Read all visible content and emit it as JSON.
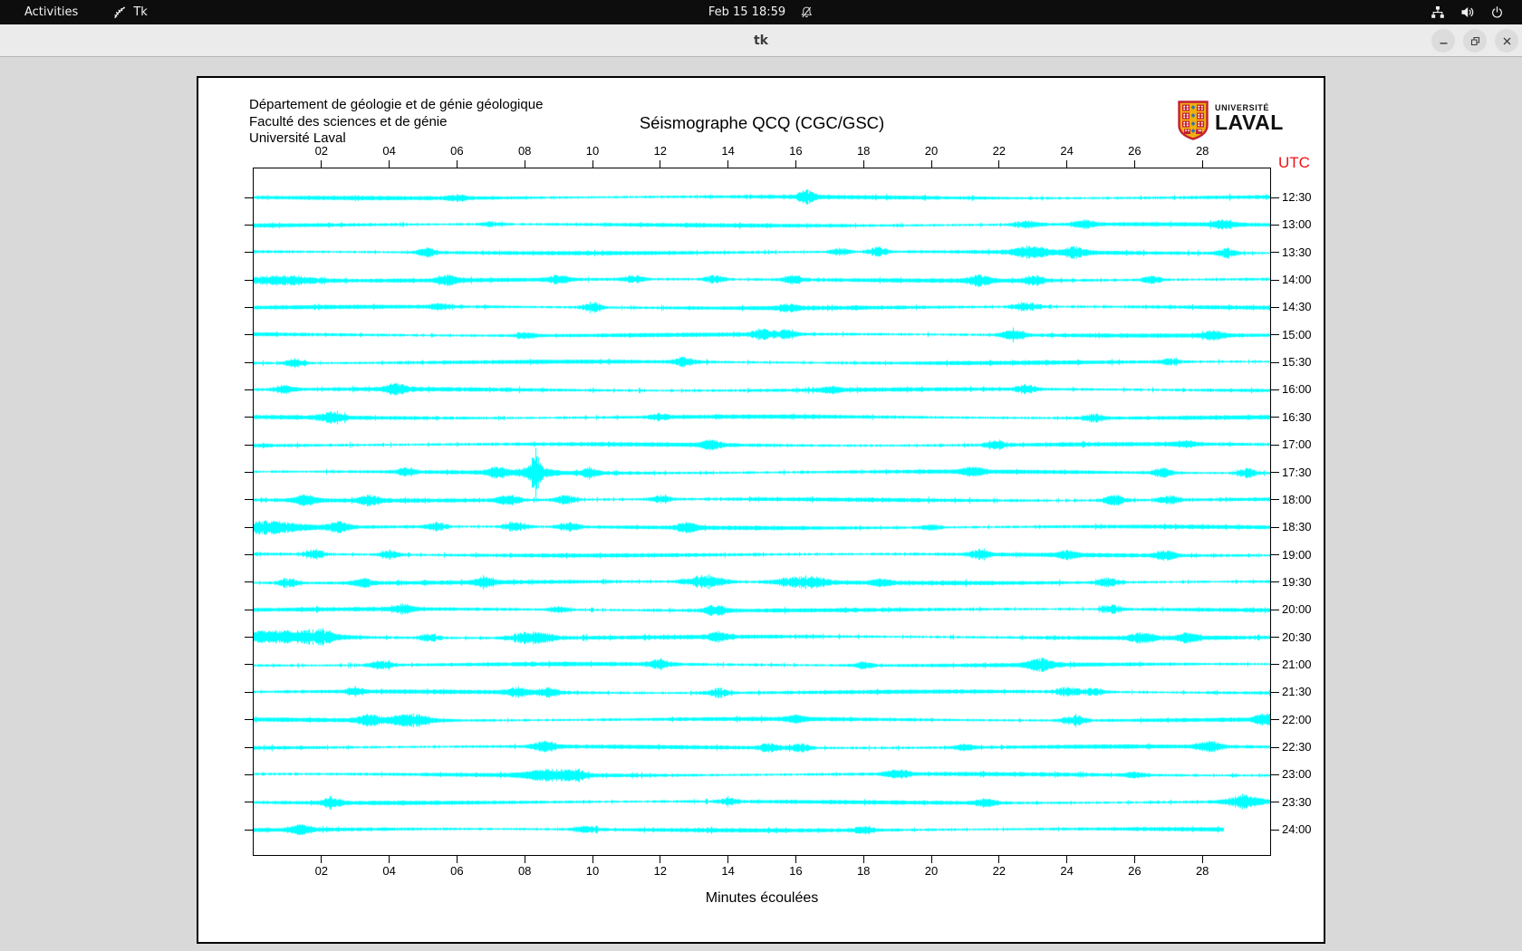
{
  "system_bar": {
    "activities_label": "Activities",
    "app_name": "Tk",
    "clock": "Feb 15 18:59"
  },
  "window": {
    "title": "tk"
  },
  "panel": {
    "header_lines": [
      "Département de géologie et de génie géologique",
      "Faculté des sciences et de génie",
      "Université Laval"
    ],
    "logo": {
      "line1": "UNIVERSITÉ",
      "line2": "LAVAL"
    }
  },
  "chart_data": {
    "type": "seismogram",
    "title": "Séismographe QCQ (CGC/GSC)",
    "xlabel": "Minutes écoulées",
    "right_axis_label": "UTC",
    "right_axis_color": "#ee1111",
    "trace_color": "#00ffff",
    "x_range_minutes": [
      0,
      30
    ],
    "x_ticks": [
      "02",
      "04",
      "06",
      "08",
      "10",
      "12",
      "14",
      "16",
      "18",
      "20",
      "22",
      "24",
      "26",
      "28"
    ],
    "rows": [
      {
        "utc": "12:30",
        "end": 30,
        "events": [
          [
            16.3,
            6,
            0.25
          ],
          [
            6.0,
            2.5,
            0.3
          ]
        ]
      },
      {
        "utc": "13:00",
        "end": 30,
        "events": [
          [
            7.0,
            2.5,
            0.3
          ],
          [
            22.8,
            3.5,
            0.4
          ],
          [
            24.5,
            3.5,
            0.3
          ],
          [
            28.6,
            3.5,
            0.3
          ]
        ]
      },
      {
        "utc": "13:30",
        "end": 30,
        "events": [
          [
            5.1,
            4.5,
            0.3
          ],
          [
            17.3,
            3.5,
            0.3
          ],
          [
            18.4,
            4.5,
            0.3
          ],
          [
            22.9,
            6,
            0.5
          ],
          [
            24.2,
            5,
            0.35
          ],
          [
            28.7,
            5,
            0.3
          ]
        ]
      },
      {
        "utc": "14:00",
        "end": 30,
        "events": [
          [
            0.8,
            5,
            1.2
          ],
          [
            5.7,
            5,
            0.3
          ],
          [
            9.0,
            4.5,
            0.3
          ],
          [
            11.2,
            4,
            0.3
          ],
          [
            13.6,
            4.5,
            0.3
          ],
          [
            15.9,
            4.5,
            0.3
          ],
          [
            21.4,
            5,
            0.35
          ],
          [
            23.0,
            4.5,
            0.3
          ],
          [
            26.5,
            3.5,
            0.3
          ]
        ]
      },
      {
        "utc": "14:30",
        "end": 30,
        "events": [
          [
            5.5,
            3,
            0.3
          ],
          [
            10.0,
            5.5,
            0.3
          ],
          [
            15.8,
            3.5,
            0.3
          ],
          [
            22.8,
            5,
            0.4
          ]
        ]
      },
      {
        "utc": "15:00",
        "end": 30,
        "events": [
          [
            8.0,
            3,
            0.3
          ],
          [
            15.0,
            5,
            0.3
          ],
          [
            15.7,
            4.5,
            0.3
          ],
          [
            22.4,
            5,
            0.35
          ],
          [
            28.3,
            4.5,
            0.3
          ]
        ]
      },
      {
        "utc": "15:30",
        "end": 30,
        "events": [
          [
            1.2,
            5,
            0.3
          ],
          [
            12.7,
            4.5,
            0.3
          ],
          [
            27.0,
            3,
            0.3
          ]
        ]
      },
      {
        "utc": "16:00",
        "end": 30,
        "events": [
          [
            0.9,
            4.5,
            0.3
          ],
          [
            4.2,
            5,
            0.35
          ],
          [
            17.0,
            3,
            0.3
          ],
          [
            22.8,
            4.5,
            0.3
          ]
        ]
      },
      {
        "utc": "16:30",
        "end": 30,
        "events": [
          [
            2.3,
            5,
            0.35
          ],
          [
            12.0,
            3,
            0.3
          ],
          [
            24.8,
            4,
            0.3
          ]
        ]
      },
      {
        "utc": "17:00",
        "end": 30,
        "events": [
          [
            13.5,
            4.5,
            0.3
          ],
          [
            21.9,
            4,
            0.3
          ],
          [
            27.5,
            3,
            0.3
          ]
        ]
      },
      {
        "utc": "17:30",
        "end": 30,
        "events": [
          [
            4.5,
            3.5,
            0.3
          ],
          [
            7.2,
            5,
            0.3
          ],
          [
            8.3,
            22,
            0.12
          ],
          [
            8.3,
            6,
            0.5
          ],
          [
            9.9,
            4.5,
            0.3
          ],
          [
            21.2,
            4.5,
            0.3
          ],
          [
            26.8,
            5,
            0.3
          ],
          [
            29.3,
            5,
            0.3
          ]
        ]
      },
      {
        "utc": "18:00",
        "end": 30,
        "events": [
          [
            1.5,
            5,
            0.35
          ],
          [
            3.4,
            4.5,
            0.3
          ],
          [
            7.5,
            5,
            0.35
          ],
          [
            9.2,
            4.5,
            0.3
          ],
          [
            12.0,
            3.5,
            0.3
          ],
          [
            25.4,
            5,
            0.35
          ],
          [
            27.0,
            4.5,
            0.3
          ]
        ]
      },
      {
        "utc": "18:30",
        "end": 30,
        "events": [
          [
            0.4,
            6,
            1.0
          ],
          [
            2.5,
            5,
            0.35
          ],
          [
            5.4,
            4.5,
            0.3
          ],
          [
            7.7,
            5,
            0.35
          ],
          [
            9.3,
            4.5,
            0.3
          ],
          [
            12.8,
            4.5,
            0.3
          ],
          [
            20.0,
            3,
            0.3
          ]
        ]
      },
      {
        "utc": "19:00",
        "end": 30,
        "events": [
          [
            1.8,
            5,
            0.3
          ],
          [
            4.0,
            4.5,
            0.3
          ],
          [
            21.4,
            4.5,
            0.3
          ],
          [
            24.0,
            3.5,
            0.3
          ],
          [
            26.9,
            4.5,
            0.3
          ]
        ]
      },
      {
        "utc": "19:30",
        "end": 30,
        "events": [
          [
            1.0,
            4.5,
            0.3
          ],
          [
            3.2,
            4.5,
            0.3
          ],
          [
            6.8,
            4.5,
            0.3
          ],
          [
            13.3,
            6.5,
            0.6
          ],
          [
            16.2,
            6,
            0.8
          ],
          [
            18.5,
            3.5,
            0.3
          ],
          [
            25.2,
            4.5,
            0.3
          ]
        ]
      },
      {
        "utc": "20:00",
        "end": 30,
        "events": [
          [
            4.4,
            4.5,
            0.3
          ],
          [
            9.0,
            3,
            0.3
          ],
          [
            13.6,
            5,
            0.35
          ],
          [
            25.3,
            4.5,
            0.3
          ]
        ]
      },
      {
        "utc": "20:30",
        "end": 30,
        "events": [
          [
            0.8,
            6,
            1.4
          ],
          [
            2.0,
            5,
            0.4
          ],
          [
            5.2,
            4.5,
            0.3
          ],
          [
            8.2,
            6,
            0.7
          ],
          [
            13.7,
            4.5,
            0.3
          ],
          [
            26.2,
            5,
            0.35
          ],
          [
            27.6,
            4.5,
            0.3
          ]
        ]
      },
      {
        "utc": "21:00",
        "end": 30,
        "events": [
          [
            3.7,
            5,
            0.35
          ],
          [
            12.0,
            4.5,
            0.3
          ],
          [
            18.0,
            3,
            0.3
          ],
          [
            23.2,
            6,
            0.4
          ]
        ]
      },
      {
        "utc": "21:30",
        "end": 30,
        "events": [
          [
            3.0,
            3,
            0.3
          ],
          [
            7.8,
            5,
            0.35
          ],
          [
            8.7,
            4.5,
            0.3
          ],
          [
            13.7,
            5,
            0.35
          ],
          [
            24.0,
            5,
            0.35
          ],
          [
            24.8,
            4.5,
            0.3
          ]
        ]
      },
      {
        "utc": "22:00",
        "end": 30,
        "events": [
          [
            3.4,
            5,
            0.35
          ],
          [
            4.6,
            6.5,
            0.6
          ],
          [
            16.0,
            3,
            0.3
          ],
          [
            24.2,
            5,
            0.35
          ],
          [
            29.8,
            6,
            0.25
          ]
        ]
      },
      {
        "utc": "22:30",
        "end": 30,
        "events": [
          [
            8.6,
            5,
            0.35
          ],
          [
            15.2,
            4.5,
            0.3
          ],
          [
            16.1,
            4.5,
            0.3
          ],
          [
            21.0,
            3,
            0.3
          ],
          [
            28.2,
            5,
            0.35
          ]
        ]
      },
      {
        "utc": "23:00",
        "end": 30,
        "events": [
          [
            8.7,
            5.5,
            0.7
          ],
          [
            9.5,
            4.5,
            0.3
          ],
          [
            19.0,
            4.5,
            0.35
          ],
          [
            26.0,
            3,
            0.3
          ]
        ]
      },
      {
        "utc": "23:30",
        "end": 30,
        "events": [
          [
            2.3,
            5,
            0.3
          ],
          [
            14.0,
            3,
            0.3
          ],
          [
            21.6,
            4.5,
            0.3
          ],
          [
            29.2,
            6,
            0.5
          ]
        ]
      },
      {
        "utc": "24:00",
        "end": 28.6,
        "events": [
          [
            1.4,
            4.5,
            0.3
          ],
          [
            9.8,
            3.5,
            0.3
          ],
          [
            18.0,
            3.5,
            0.3
          ]
        ]
      }
    ]
  }
}
